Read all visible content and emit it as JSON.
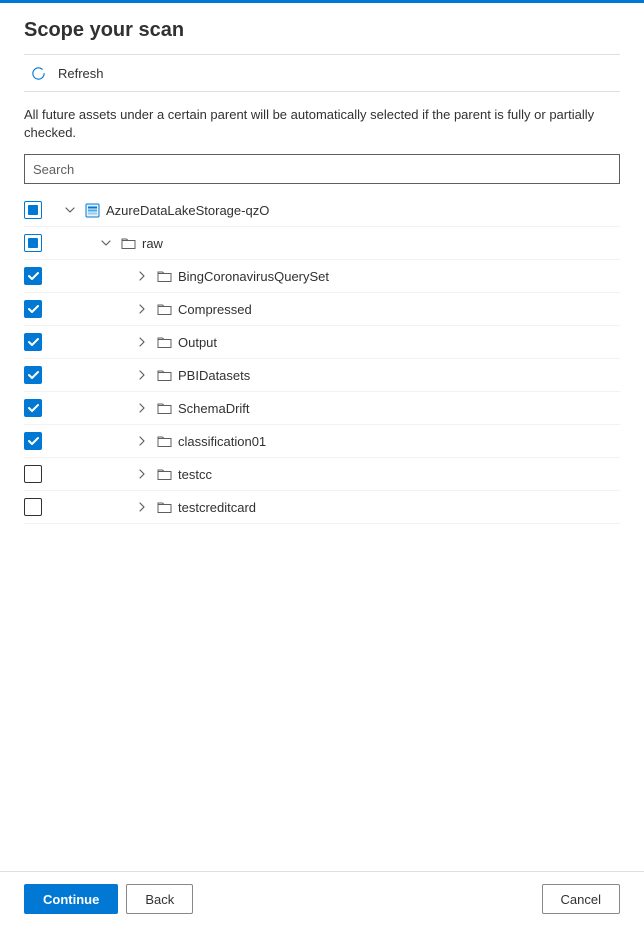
{
  "title": "Scope your scan",
  "refresh_label": "Refresh",
  "description": "All future assets under a certain parent will be automatically selected if the parent is fully or partially checked.",
  "search_placeholder": "Search",
  "tree": [
    {
      "indent": 0,
      "check": "partial",
      "expander": "down",
      "icon": "storage",
      "label": "AzureDataLakeStorage-qzO"
    },
    {
      "indent": 1,
      "check": "partial",
      "expander": "down",
      "icon": "folder",
      "label": "raw"
    },
    {
      "indent": 2,
      "check": "checked",
      "expander": "right",
      "icon": "folder",
      "label": "BingCoronavirusQuerySet"
    },
    {
      "indent": 2,
      "check": "checked",
      "expander": "right",
      "icon": "folder",
      "label": "Compressed"
    },
    {
      "indent": 2,
      "check": "checked",
      "expander": "right",
      "icon": "folder",
      "label": "Output"
    },
    {
      "indent": 2,
      "check": "checked",
      "expander": "right",
      "icon": "folder",
      "label": "PBIDatasets"
    },
    {
      "indent": 2,
      "check": "checked",
      "expander": "right",
      "icon": "folder",
      "label": "SchemaDrift"
    },
    {
      "indent": 2,
      "check": "checked",
      "expander": "right",
      "icon": "folder",
      "label": "classification01"
    },
    {
      "indent": 2,
      "check": "none",
      "expander": "right",
      "icon": "folder",
      "label": "testcc"
    },
    {
      "indent": 2,
      "check": "none",
      "expander": "right",
      "icon": "folder",
      "label": "testcreditcard"
    }
  ],
  "buttons": {
    "continue": "Continue",
    "back": "Back",
    "cancel": "Cancel"
  }
}
